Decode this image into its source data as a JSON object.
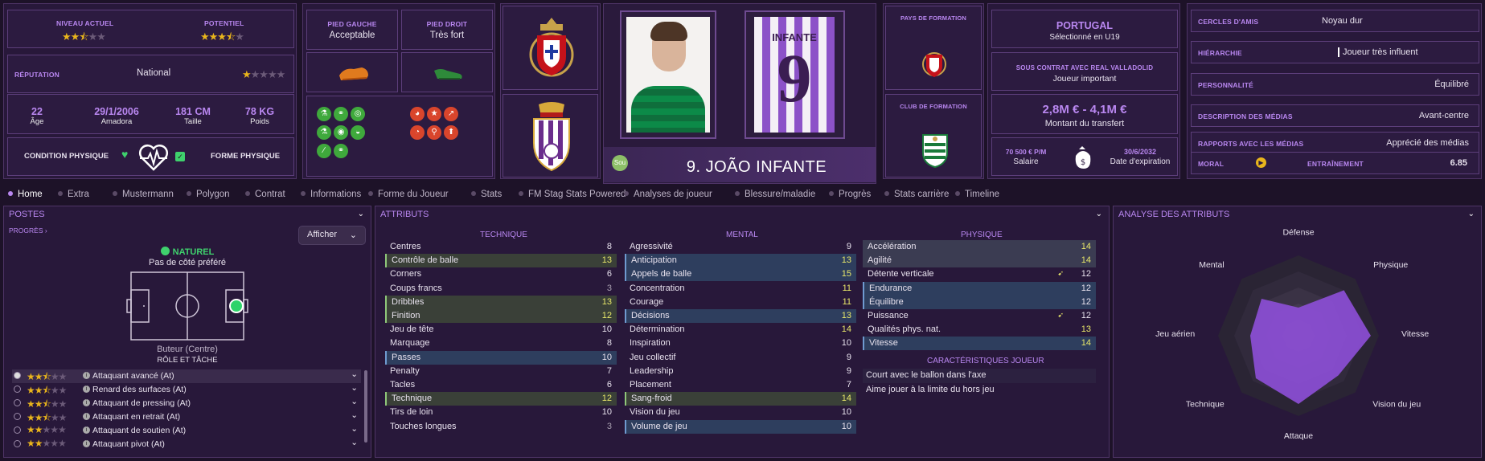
{
  "header": {
    "niveau_label": "NIVEAU ACTUEL",
    "potentiel_label": "POTENTIEL",
    "niveau_stars": 2.5,
    "potentiel_stars": 3.5,
    "reputation_label": "RÉPUTATION",
    "reputation_value": "National",
    "reputation_stars": 1,
    "age": "22",
    "age_label": "Âge",
    "dob": "29/1/2006",
    "club_origin": "Amadora",
    "height": "181 CM",
    "height_label": "Taille",
    "weight": "78 KG",
    "weight_label": "Poids",
    "condition_label": "CONDITION PHYSIQUE",
    "forme_label": "FORME PHYSIQUE",
    "pied_gauche_label": "PIED GAUCHE",
    "pied_gauche_value": "Acceptable",
    "pied_droit_label": "PIED DROIT",
    "pied_droit_value": "Très fort",
    "player_name": "9. JOÃO INFANTE",
    "shirt_name": "INFANTE",
    "shirt_number": "9",
    "badge_small": "Sou",
    "pays_formation_label": "PAYS DE FORMATION",
    "club_formation_label": "CLUB DE FORMATION",
    "nation": "PORTUGAL",
    "nation_sub": "Sélectionné en U19",
    "contract_label": "SOUS CONTRAT AVEC REAL VALLADOLID",
    "contract_status": "Joueur important",
    "transfer_value": "2,8M € - 4,1M €",
    "transfer_label": "Montant du transfert",
    "salary": "70 500 € P/M",
    "salary_label": "Salaire",
    "expiry": "30/6/2032",
    "expiry_label": "Date d'expiration",
    "info": [
      {
        "label": "CERCLES D'AMIS",
        "value": "Noyau dur"
      },
      {
        "label": "HIÉRARCHIE",
        "value": "Joueur très influent"
      },
      {
        "label": "PERSONNALITÉ",
        "value": "Équilibré"
      },
      {
        "label": "DESCRIPTION DES MÉDIAS",
        "value": "Avant-centre"
      },
      {
        "label": "RAPPORTS AVEC LES MÉDIAS",
        "value": "Apprécié des médias"
      }
    ],
    "moral_label": "MORAL",
    "training_label": "ENTRAÎNEMENT",
    "training_value": "6.85"
  },
  "tabs": [
    "Home",
    "Extra",
    "Mustermann",
    "Polygon",
    "Contrat",
    "Informations",
    "Forme du Joueur",
    "Stats",
    "FM Stag Stats Powered",
    "Analyses de joueur",
    "Blessure/maladie",
    "Progrès",
    "Stats carrière",
    "Timeline"
  ],
  "postes": {
    "title": "POSTES",
    "progres": "PROGRÈS",
    "afficher": "Afficher",
    "naturel": "NATUREL",
    "side": "Pas de côté préféré",
    "position": "Buteur (Centre)",
    "role_title": "RÔLE ET TÂCHE",
    "roles": [
      {
        "name": "Attaquant avancé (At)",
        "stars": 2.5
      },
      {
        "name": "Renard des surfaces (At)",
        "stars": 2.5
      },
      {
        "name": "Attaquant de pressing (At)",
        "stars": 2.5
      },
      {
        "name": "Attaquant en retrait (At)",
        "stars": 2.5
      },
      {
        "name": "Attaquant de soutien (At)",
        "stars": 2
      },
      {
        "name": "Attaquant pivot (At)",
        "stars": 2
      }
    ]
  },
  "attributs": {
    "title": "ATTRIBUTS",
    "technique_label": "TECHNIQUE",
    "mental_label": "MENTAL",
    "physique_label": "PHYSIQUE",
    "technique": [
      {
        "n": "Centres",
        "v": "8"
      },
      {
        "n": "Contrôle de balle",
        "v": "13"
      },
      {
        "n": "Corners",
        "v": "6"
      },
      {
        "n": "Coups francs",
        "v": "3"
      },
      {
        "n": "Dribbles",
        "v": "13"
      },
      {
        "n": "Finition",
        "v": "12"
      },
      {
        "n": "Jeu de tête",
        "v": "10"
      },
      {
        "n": "Marquage",
        "v": "8"
      },
      {
        "n": "Passes",
        "v": "10"
      },
      {
        "n": "Penalty",
        "v": "7"
      },
      {
        "n": "Tacles",
        "v": "6"
      },
      {
        "n": "Technique",
        "v": "12"
      },
      {
        "n": "Tirs de loin",
        "v": "10"
      },
      {
        "n": "Touches longues",
        "v": "3"
      }
    ],
    "mental": [
      {
        "n": "Agressivité",
        "v": "9"
      },
      {
        "n": "Anticipation",
        "v": "13"
      },
      {
        "n": "Appels de balle",
        "v": "15"
      },
      {
        "n": "Concentration",
        "v": "11"
      },
      {
        "n": "Courage",
        "v": "11"
      },
      {
        "n": "Décisions",
        "v": "13"
      },
      {
        "n": "Détermination",
        "v": "14"
      },
      {
        "n": "Inspiration",
        "v": "10"
      },
      {
        "n": "Jeu collectif",
        "v": "9"
      },
      {
        "n": "Leadership",
        "v": "9"
      },
      {
        "n": "Placement",
        "v": "7"
      },
      {
        "n": "Sang-froid",
        "v": "14"
      },
      {
        "n": "Vision du jeu",
        "v": "10"
      },
      {
        "n": "Volume de jeu",
        "v": "10"
      }
    ],
    "physique": [
      {
        "n": "Accélération",
        "v": "14"
      },
      {
        "n": "Agilité",
        "v": "14"
      },
      {
        "n": "Détente verticale",
        "v": "12"
      },
      {
        "n": "Endurance",
        "v": "12"
      },
      {
        "n": "Équilibre",
        "v": "12"
      },
      {
        "n": "Puissance",
        "v": "12"
      },
      {
        "n": "Qualités phys. nat.",
        "v": "13"
      },
      {
        "n": "Vitesse",
        "v": "14"
      }
    ],
    "traits_label": "CARACTÉRISTIQUES JOUEUR",
    "traits": [
      "Court avec le ballon dans l'axe",
      "Aime jouer à la limite du hors jeu"
    ]
  },
  "analyse": {
    "title": "ANALYSE DES ATTRIBUTS",
    "axes": [
      "Défense",
      "Physique",
      "Vitesse",
      "Vision du jeu",
      "Attaque",
      "Technique",
      "Jeu aérien",
      "Mental"
    ],
    "values": [
      0.35,
      0.8,
      0.9,
      0.7,
      0.85,
      0.75,
      0.6,
      0.65
    ],
    "color": "#8e4fd8"
  }
}
